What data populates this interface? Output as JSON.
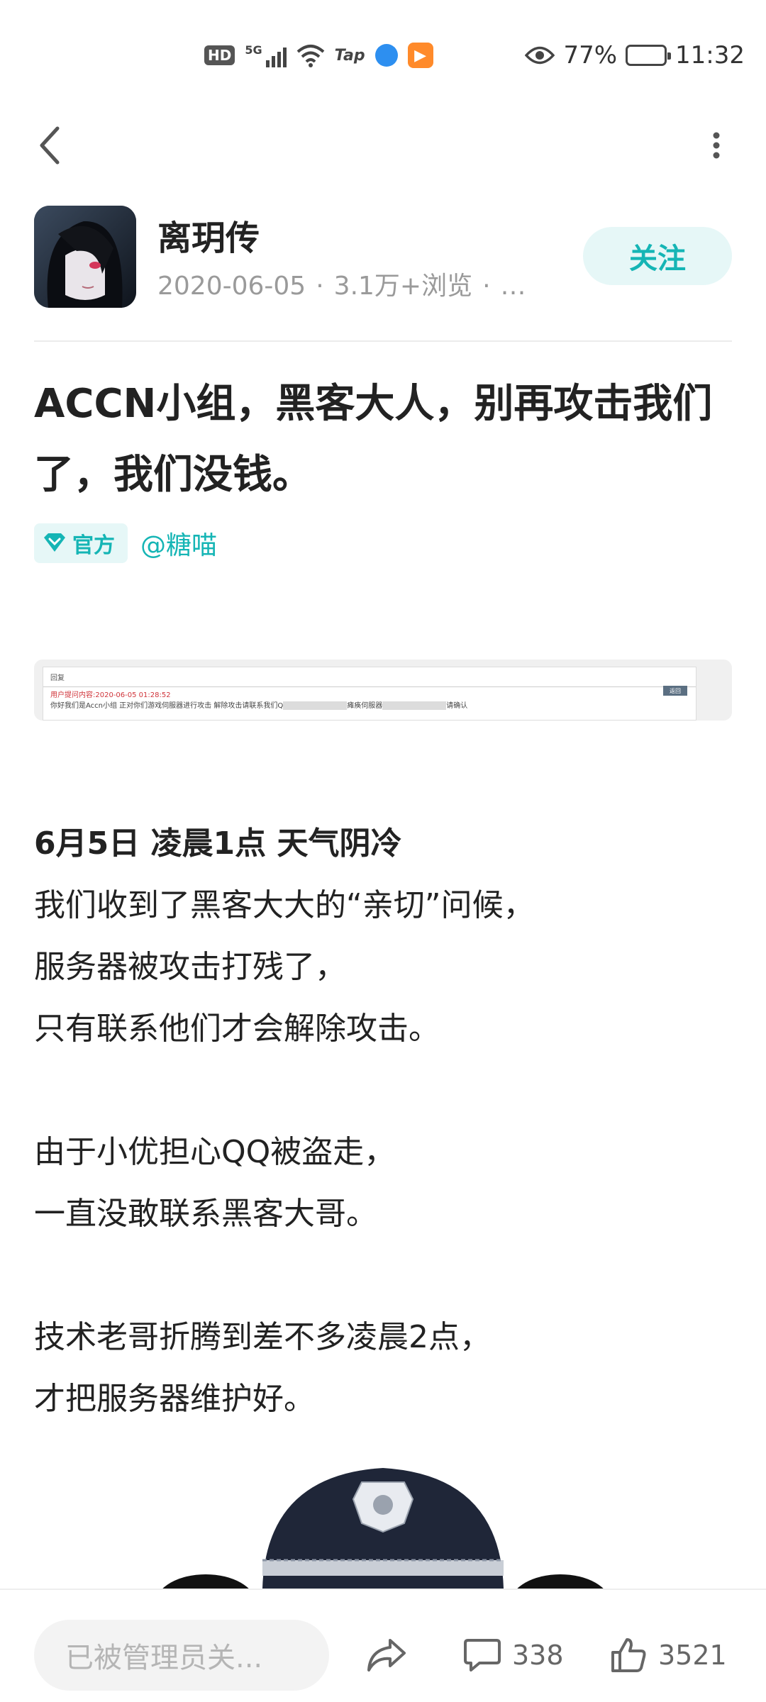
{
  "status_bar": {
    "hd": "HD",
    "network": "5G",
    "tap_label": "Tap",
    "battery": "77%",
    "battery_level": 0.77,
    "time": "11:32"
  },
  "nav": {
    "back_icon": "chevron-left-icon",
    "more_icon": "more-vertical-icon"
  },
  "author": {
    "name": "离玥传",
    "date": "2020-06-05",
    "views": "3.1万+浏览",
    "more": "…",
    "follow_label": "关注"
  },
  "post": {
    "title": "ACCN小组，黑客大人，别再攻击我们了，我们没钱。",
    "official_tag": "官方",
    "mention": "@糖喵",
    "screenshot": {
      "header": "回复",
      "red_line": "用户提问内容:2020-06-05 01:28:52",
      "text_a": "你好我们是Accn小组 正对你们游戏伺服器进行攻击 解除攻击请联系我们Q",
      "text_b": "瘫痪伺服器",
      "text_c": "请确认",
      "button": "返回"
    },
    "body_lines": [
      "6月5日 凌晨1点 天气阴冷",
      "我们收到了黑客大大的“亲切”问候，",
      "服务器被攻击打残了，",
      "只有联系他们才会解除攻击。",
      "",
      "由于小优担心QQ被盗走，",
      "一直没敢联系黑客大哥。",
      "",
      "技术老哥折腾到差不多凌晨2点，",
      "才把服务器维护好。"
    ]
  },
  "bottom_bar": {
    "comment_placeholder": "已被管理员关...",
    "comment_count": "338",
    "like_count": "3521"
  },
  "colors": {
    "accent": "#15b5b5",
    "accent_bg": "#e6f7f7"
  }
}
